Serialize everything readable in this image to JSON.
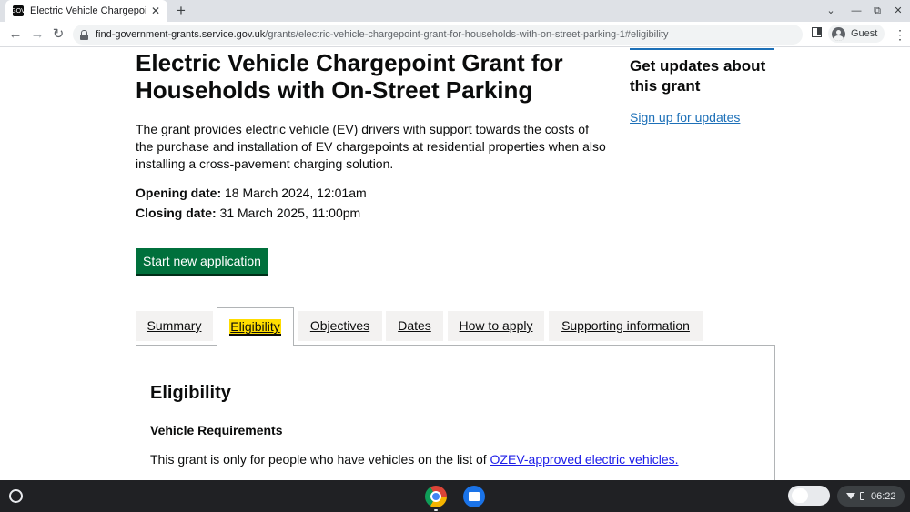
{
  "browser": {
    "tab_title": "Electric Vehicle Chargepoint Gra",
    "tab_close": "✕",
    "new_tab": "+",
    "favicon_text": "GOV",
    "url_host": "find-government-grants.service.gov.uk",
    "url_path": "/grants/electric-vehicle-chargepoint-grant-for-households-with-on-street-parking-1#eligibility",
    "profile_name": "Guest",
    "controls": {
      "dropdown": "⌄",
      "minimize": "—",
      "restore": "⧉",
      "close": "✕"
    },
    "nav": {
      "back": "←",
      "forward": "→",
      "reload": "↻",
      "menu": "⋮"
    }
  },
  "page": {
    "title": "Electric Vehicle Chargepoint Grant for Households with On-Street Parking",
    "description": "The grant provides electric vehicle (EV) drivers with support towards the costs of the purchase and installation of EV chargepoints at residential properties when also installing a cross-pavement charging solution.",
    "opening_label": "Opening date:",
    "opening_value": " 18 March 2024, 12:01am",
    "closing_label": "Closing date:",
    "closing_value": " 31 March 2025, 11:00pm",
    "start_button": "Start new application",
    "aside": {
      "heading": "Get updates about this grant",
      "link": "Sign up for updates"
    },
    "tabs": [
      "Summary",
      "Eligibility",
      "Objectives",
      "Dates",
      "How to apply",
      "Supporting information"
    ],
    "active_tab": "Eligibility",
    "panel": {
      "heading": "Eligibility",
      "subheading": "Vehicle Requirements",
      "text": "This grant is only for people who have vehicles on the list of ",
      "link": "OZEV-approved electric vehicles."
    }
  },
  "shelf": {
    "time": "06:22",
    "apps": [
      "chrome-icon",
      "files-icon"
    ]
  },
  "colors": {
    "start_button": "#00703c",
    "link": "#1d70b8",
    "focus": "#ffdd00"
  }
}
